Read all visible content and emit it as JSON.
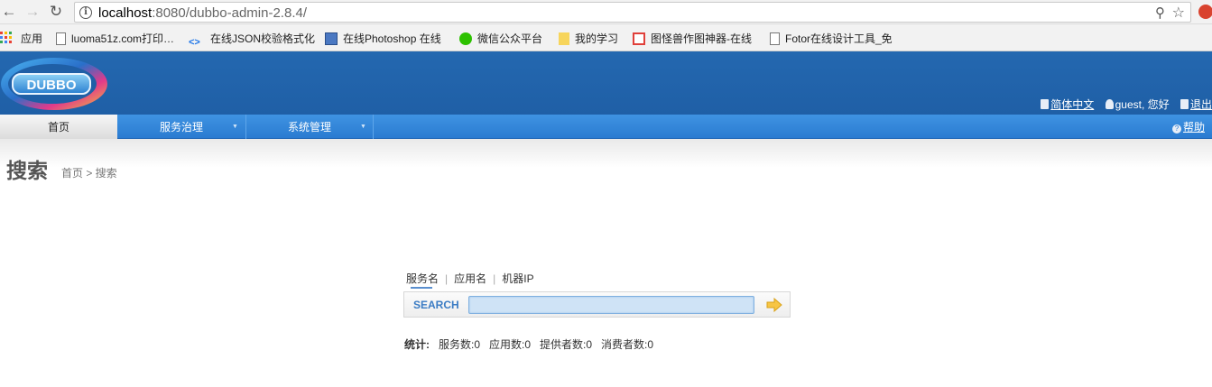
{
  "browser": {
    "url_host": "localhost",
    "url_rest": ":8080/dubbo-admin-2.8.4/"
  },
  "bookmarks": [
    {
      "label": "应用",
      "icon": "apps-grid-icon"
    },
    {
      "label": "luoma51z.com打印…",
      "icon": "page-icon"
    },
    {
      "label": "在线JSON校验格式化",
      "icon": "code-icon"
    },
    {
      "label": "在线Photoshop 在线",
      "icon": "monitor-icon"
    },
    {
      "label": "微信公众平台",
      "icon": "wechat-icon"
    },
    {
      "label": "我的学习",
      "icon": "folder-icon"
    },
    {
      "label": "图怪兽作图神器-在线",
      "icon": "tuguaishou-icon"
    },
    {
      "label": "Fotor在线设计工具_免",
      "icon": "page-icon"
    }
  ],
  "header": {
    "logo_text": "DUBBO",
    "language": "简体中文",
    "greeting": "guest, 您好",
    "logout": "退出"
  },
  "menu": {
    "items": [
      {
        "label": "首页",
        "active": true
      },
      {
        "label": "服务治理",
        "active": false
      },
      {
        "label": "系统管理",
        "active": false
      }
    ],
    "help": "帮助"
  },
  "page": {
    "title": "搜索",
    "breadcrumb": "首页 > 搜索"
  },
  "search": {
    "tabs": [
      "服务名",
      "应用名",
      "机器IP"
    ],
    "label": "SEARCH",
    "value": ""
  },
  "stats": {
    "title": "统计:",
    "services": "服务数:0",
    "applications": "应用数:0",
    "providers": "提供者数:0",
    "consumers": "消费者数:0"
  },
  "colors": {
    "header_blue": "#2468b0",
    "menu_blue": "#2a7bd1",
    "search_label": "#3b7cc4"
  }
}
